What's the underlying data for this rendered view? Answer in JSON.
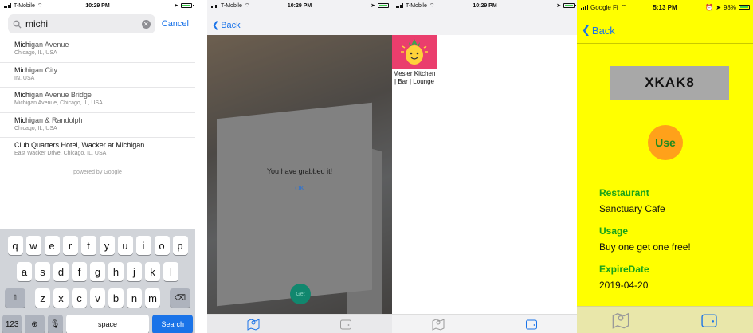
{
  "screen1": {
    "status": {
      "carrier": "T-Mobile",
      "time": "10:29 PM"
    },
    "search": {
      "query": "michi",
      "cancel_label": "Cancel"
    },
    "results": [
      {
        "match": "Michi",
        "rest": "gan Avenue",
        "subtitle": "Chicago, IL, USA"
      },
      {
        "match": "Michi",
        "rest": "gan City",
        "subtitle": "IN, USA"
      },
      {
        "match": "Michi",
        "rest": "gan Avenue Bridge",
        "subtitle": "Michigan Avenue, Chicago, IL, USA"
      },
      {
        "match": "Michi",
        "rest": "gan & Randolph",
        "subtitle": "Chicago, IL, USA"
      },
      {
        "match": "Club Quarters Hotel, Wacker at Michigan",
        "rest": "",
        "subtitle": "East Wacker Drive, Chicago, IL, USA"
      }
    ],
    "powered_by": "powered by Google",
    "keyboard": {
      "row1": [
        "q",
        "w",
        "e",
        "r",
        "t",
        "y",
        "u",
        "i",
        "o",
        "p"
      ],
      "row2": [
        "a",
        "s",
        "d",
        "f",
        "g",
        "h",
        "j",
        "k",
        "l"
      ],
      "row3": [
        "z",
        "x",
        "c",
        "v",
        "b",
        "n",
        "m"
      ],
      "shift": "⇧",
      "delete": "⌫",
      "numbers": "123",
      "globe": "⊕",
      "mic": "🎙",
      "space": "space",
      "search": "Search"
    }
  },
  "screen2": {
    "status": {
      "carrier": "T-Mobile",
      "time": "10:29 PM"
    },
    "back_label": "Back",
    "alert": {
      "message": "You have grabbed it!",
      "ok": "OK"
    },
    "get_label": "Get"
  },
  "screen3": {
    "status": {
      "carrier": "T-Mobile",
      "time": "10:29 PM"
    },
    "item": {
      "name": "Mesler Kitchen | Bar | Lounge"
    }
  },
  "screen4": {
    "status": {
      "carrier": "Google Fi",
      "time": "5:13 PM",
      "battery": "98%"
    },
    "back_label": "Back",
    "code": "XKAK8",
    "use_label": "Use",
    "fields": [
      {
        "label": "Restaurant",
        "value": "Sanctuary Cafe"
      },
      {
        "label": "Usage",
        "value": "Buy one get one free!"
      },
      {
        "label": "ExpireDate",
        "value": "2019-04-20"
      }
    ],
    "colors": {
      "background": "#ffff00",
      "accent": "#ffa11a",
      "label": "#19a319",
      "link": "#1a73e8"
    }
  }
}
